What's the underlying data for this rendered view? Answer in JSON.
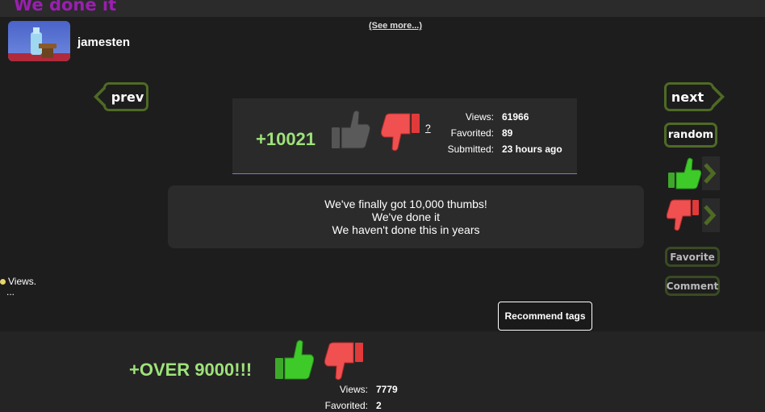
{
  "page": {
    "title": "We done it",
    "see_more": "(See more...)"
  },
  "author": {
    "username": "jamesten"
  },
  "nav": {
    "prev_label": "prev",
    "next_label": "next",
    "random_label": "random",
    "favorite_label": "Favorite",
    "comment_label": "Comment"
  },
  "stats": {
    "score": "+10021",
    "help_link": "?",
    "views_label": "Views:",
    "views_value": "61966",
    "favorited_label": "Favorited:",
    "favorited_value": "89",
    "submitted_label": "Submitted:",
    "submitted_value": "23 hours ago"
  },
  "description": {
    "lines": [
      "We've finally got 10,000 thumbs!",
      "We've done it",
      "We haven't done this in years"
    ]
  },
  "left_panel": {
    "views_text": "Views.",
    "ellipsis": "..."
  },
  "recommend_tags_label": "Recommend tags",
  "next_post": {
    "score": "+OVER 9000!!!",
    "views_label": "Views:",
    "views_value": "7779",
    "favorited_label": "Favorited:",
    "favorited_value": "2"
  },
  "colors": {
    "title": "#9a1fb0",
    "score": "#9ee27a",
    "button_border": "#4e6a25",
    "accent_line": "#8478c8"
  },
  "icons": [
    "thumbs-up-gray-icon",
    "thumbs-down-red-icon",
    "thumbs-up-green-icon",
    "chevron-right-icon"
  ]
}
